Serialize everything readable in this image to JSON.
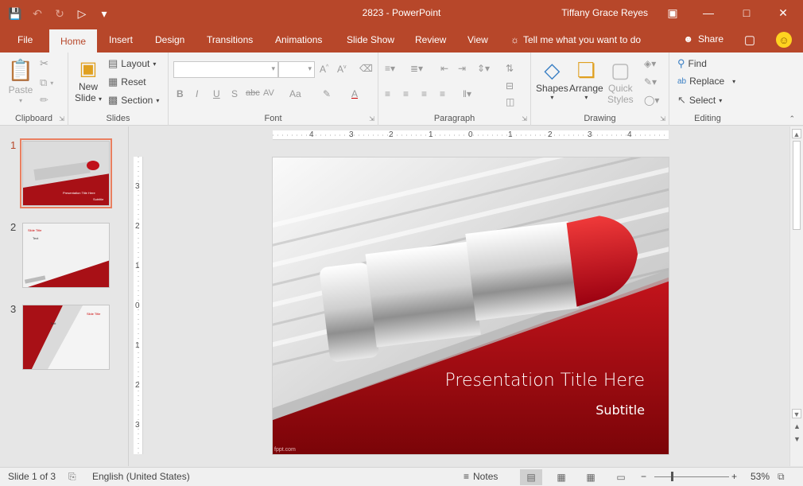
{
  "window": {
    "doc_title": "2823  -  PowerPoint",
    "user_name": "Tiffany Grace Reyes",
    "qat": [
      "save-icon",
      "undo-icon",
      "redo-icon",
      "present-icon",
      "customize-icon"
    ],
    "accent": "#b7472a"
  },
  "tabs": [
    "File",
    "Home",
    "Insert",
    "Design",
    "Transitions",
    "Animations",
    "Slide Show",
    "Review",
    "View"
  ],
  "active_tab": "Home",
  "tell_me": "Tell me what you want to do",
  "share": "Share",
  "ribbon": {
    "clipboard": {
      "label": "Clipboard",
      "paste": "Paste"
    },
    "slides": {
      "label": "Slides",
      "new_slide_1": "New",
      "new_slide_2": "Slide",
      "layout": "Layout",
      "reset": "Reset",
      "section": "Section"
    },
    "font": {
      "label": "Font",
      "name_value": "",
      "size_value": "",
      "bold": "B",
      "italic": "I",
      "underline": "U",
      "shadow": "S",
      "strike": "abc",
      "spacing": "AV",
      "case": "Aa",
      "clear": "A"
    },
    "paragraph": {
      "label": "Paragraph"
    },
    "drawing": {
      "label": "Drawing",
      "shapes": "Shapes",
      "arrange": "Arrange",
      "quick_styles_1": "Quick",
      "quick_styles_2": "Styles"
    },
    "editing": {
      "label": "Editing",
      "find": "Find",
      "replace": "Replace",
      "select": "Select"
    }
  },
  "thumbnails": [
    {
      "number": "1",
      "title": "Presentation Title Here",
      "subtitle": "Subtitle"
    },
    {
      "number": "2",
      "title": "Slide Title",
      "body": "Text"
    },
    {
      "number": "3",
      "title": "Slide Title",
      "body": "Text"
    }
  ],
  "hruler_labels": [
    "4",
    "3",
    "2",
    "1",
    "0",
    "1",
    "2",
    "3",
    "4"
  ],
  "vruler_labels": [
    "3",
    "2",
    "1",
    "0",
    "1",
    "2",
    "3"
  ],
  "slide": {
    "title": "Presentation Title Here",
    "subtitle": "Subtitle",
    "credit": "fppt.com"
  },
  "status": {
    "slide_info": "Slide 1 of 3",
    "language": "English (United States)",
    "notes": "Notes",
    "zoom": "53%",
    "zoom_minus": "−",
    "zoom_plus": "+"
  }
}
